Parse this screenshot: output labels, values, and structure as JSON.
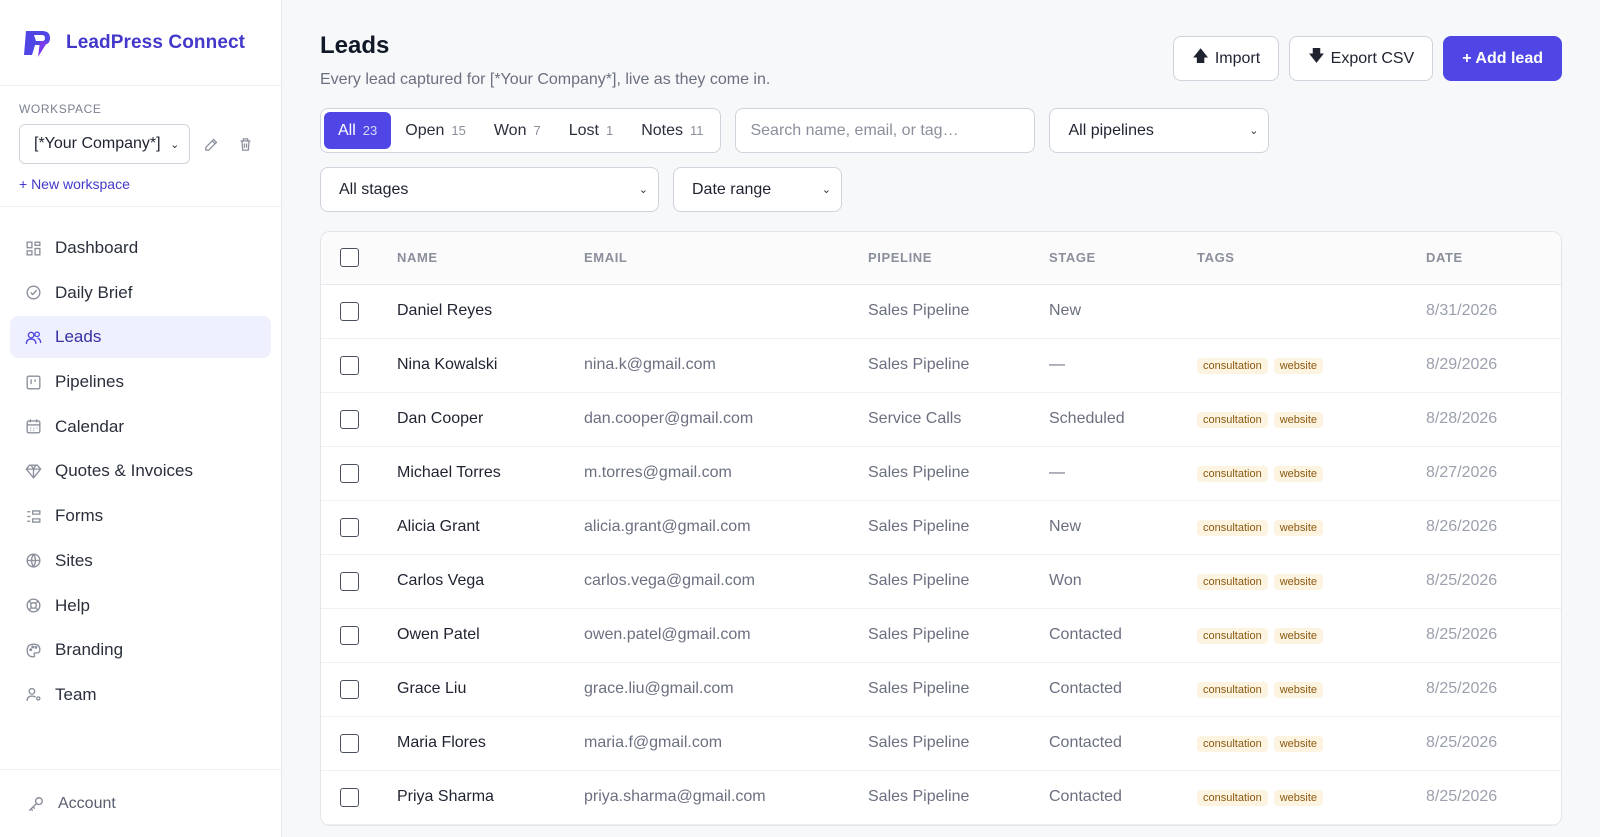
{
  "brand": {
    "name": "LeadPress Connect"
  },
  "workspace": {
    "label": "WORKSPACE",
    "selected": "[*Your Company*]",
    "new_label": "+ New workspace"
  },
  "nav": [
    {
      "label": "Dashboard",
      "icon": "dashboard-icon",
      "active": false
    },
    {
      "label": "Daily Brief",
      "icon": "check-circle-icon",
      "active": false
    },
    {
      "label": "Leads",
      "icon": "users-icon",
      "active": true
    },
    {
      "label": "Pipelines",
      "icon": "pipeline-icon",
      "active": false
    },
    {
      "label": "Calendar",
      "icon": "calendar-icon",
      "active": false
    },
    {
      "label": "Quotes & Invoices",
      "icon": "diamond-icon",
      "active": false
    },
    {
      "label": "Forms",
      "icon": "forms-icon",
      "active": false
    },
    {
      "label": "Sites",
      "icon": "globe-icon",
      "active": false
    },
    {
      "label": "Help",
      "icon": "lifebuoy-icon",
      "active": false
    },
    {
      "label": "Branding",
      "icon": "palette-icon",
      "active": false
    },
    {
      "label": "Team",
      "icon": "user-icon",
      "active": false
    }
  ],
  "account": {
    "label": "Account"
  },
  "header": {
    "title": "Leads",
    "subtitle": "Every lead captured for [*Your Company*], live as they come in.",
    "import_label": "Import",
    "export_label": "Export CSV",
    "add_label": "+ Add lead"
  },
  "filters": {
    "tabs": [
      {
        "label": "All",
        "count": "23",
        "active": true
      },
      {
        "label": "Open",
        "count": "15",
        "active": false
      },
      {
        "label": "Won",
        "count": "7",
        "active": false
      },
      {
        "label": "Lost",
        "count": "1",
        "active": false
      },
      {
        "label": "Notes",
        "count": "11",
        "active": false
      }
    ],
    "search_placeholder": "Search name, email, or tag…",
    "pipeline_select": "All pipelines",
    "stage_select": "All stages",
    "date_select": "Date range"
  },
  "table": {
    "columns": [
      "NAME",
      "EMAIL",
      "PIPELINE",
      "STAGE",
      "TAGS",
      "DATE"
    ],
    "rows": [
      {
        "name": "Daniel Reyes",
        "email": "",
        "pipeline": "Sales Pipeline",
        "stage": "New",
        "tags": [],
        "date": "8/31/2026"
      },
      {
        "name": "Nina Kowalski",
        "email": "nina.k@gmail.com",
        "pipeline": "Sales Pipeline",
        "stage": "—",
        "tags": [
          "consultation",
          "website"
        ],
        "date": "8/29/2026"
      },
      {
        "name": "Dan Cooper",
        "email": "dan.cooper@gmail.com",
        "pipeline": "Service Calls",
        "stage": "Scheduled",
        "tags": [
          "consultation",
          "website"
        ],
        "date": "8/28/2026"
      },
      {
        "name": "Michael Torres",
        "email": "m.torres@gmail.com",
        "pipeline": "Sales Pipeline",
        "stage": "—",
        "tags": [
          "consultation",
          "website"
        ],
        "date": "8/27/2026"
      },
      {
        "name": "Alicia Grant",
        "email": "alicia.grant@gmail.com",
        "pipeline": "Sales Pipeline",
        "stage": "New",
        "tags": [
          "consultation",
          "website"
        ],
        "date": "8/26/2026"
      },
      {
        "name": "Carlos Vega",
        "email": "carlos.vega@gmail.com",
        "pipeline": "Sales Pipeline",
        "stage": "Won",
        "tags": [
          "consultation",
          "website"
        ],
        "date": "8/25/2026"
      },
      {
        "name": "Owen Patel",
        "email": "owen.patel@gmail.com",
        "pipeline": "Sales Pipeline",
        "stage": "Contacted",
        "tags": [
          "consultation",
          "website"
        ],
        "date": "8/25/2026"
      },
      {
        "name": "Grace Liu",
        "email": "grace.liu@gmail.com",
        "pipeline": "Sales Pipeline",
        "stage": "Contacted",
        "tags": [
          "consultation",
          "website"
        ],
        "date": "8/25/2026"
      },
      {
        "name": "Maria Flores",
        "email": "maria.f@gmail.com",
        "pipeline": "Sales Pipeline",
        "stage": "Contacted",
        "tags": [
          "consultation",
          "website"
        ],
        "date": "8/25/2026"
      },
      {
        "name": "Priya Sharma",
        "email": "priya.sharma@gmail.com",
        "pipeline": "Sales Pipeline",
        "stage": "Contacted",
        "tags": [
          "consultation",
          "website"
        ],
        "date": "8/25/2026"
      }
    ]
  },
  "colors": {
    "accent": "#4f46e5",
    "brand": "#4338ca",
    "tag_bg": "#fdf3e1",
    "tag_text": "#8a5a10"
  }
}
